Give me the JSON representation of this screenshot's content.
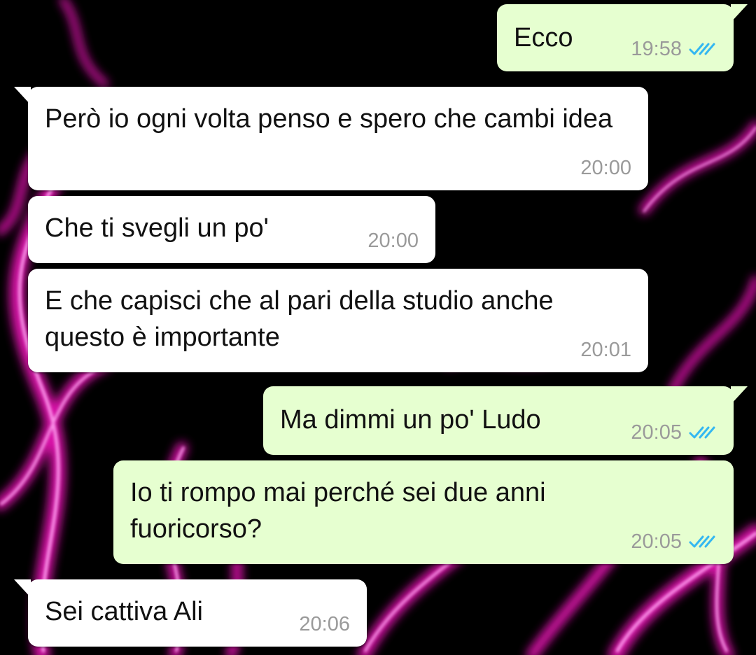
{
  "colors": {
    "incoming_bubble": "#ffffff",
    "outgoing_bubble": "#e6ffd0",
    "read_ticks": "#34b7f1",
    "timestamp": "#9a9a9a",
    "wallpaper_base": "#000000",
    "wallpaper_flame": "#ff20c8"
  },
  "wallpaper": "pink-flames-on-black",
  "messages": [
    {
      "direction": "outgoing",
      "text": "Ecco",
      "time": "19:58",
      "status_icon": "double-check-read-icon"
    },
    {
      "direction": "incoming",
      "text": "Però io ogni volta penso e spero che cambi idea",
      "time": "20:00"
    },
    {
      "direction": "incoming",
      "text": "Che ti svegli un po'",
      "time": "20:00"
    },
    {
      "direction": "incoming",
      "text": "E che capisci che al pari della studio anche questo è importante",
      "time": "20:01"
    },
    {
      "direction": "outgoing",
      "text": "Ma dimmi un po' Ludo",
      "time": "20:05",
      "status_icon": "double-check-read-icon"
    },
    {
      "direction": "outgoing",
      "text": "Io ti rompo mai perché sei due anni fuoricorso?",
      "time": "20:05",
      "status_icon": "double-check-read-icon"
    },
    {
      "direction": "incoming",
      "text": "Sei cattiva Ali",
      "time": "20:06"
    }
  ]
}
